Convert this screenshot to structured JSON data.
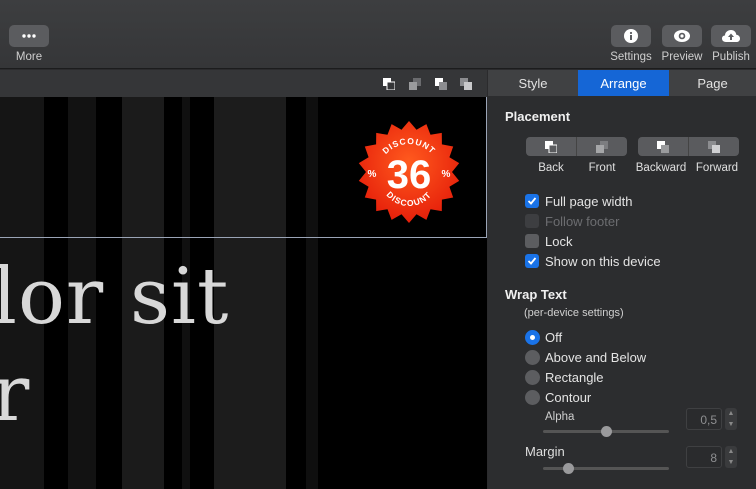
{
  "toolbar": {
    "more_label": "More",
    "settings_label": "Settings",
    "preview_label": "Preview",
    "publish_label": "Publish"
  },
  "canvas": {
    "headline_line1": "lor sit",
    "headline_line2": "r",
    "badge": {
      "top_text": "DISCOUNT",
      "bottom_text": "DISCOUNT",
      "value": "36",
      "left_pct": "%",
      "right_pct": "%"
    }
  },
  "inspector": {
    "tabs": [
      "Style",
      "Arrange",
      "Page"
    ],
    "active_tab": "Arrange",
    "placement": {
      "title": "Placement",
      "buttons": [
        "Back",
        "Front",
        "Backward",
        "Forward"
      ],
      "options": [
        {
          "label": "Full page width",
          "checked": true,
          "enabled": true
        },
        {
          "label": "Follow footer",
          "checked": false,
          "enabled": false
        },
        {
          "label": "Lock",
          "checked": false,
          "enabled": true
        },
        {
          "label": "Show on this device",
          "checked": true,
          "enabled": true
        }
      ]
    },
    "wrap_text": {
      "title": "Wrap Text",
      "subtitle": "(per-device settings)",
      "options": [
        {
          "label": "Off",
          "selected": true
        },
        {
          "label": "Above and Below",
          "selected": false
        },
        {
          "label": "Rectangle",
          "selected": false
        },
        {
          "label": "Contour",
          "selected": false
        }
      ],
      "alpha_label": "Alpha",
      "alpha_value": "0,5",
      "alpha_fraction": 0.5,
      "margin_label": "Margin",
      "margin_value": "8",
      "margin_fraction": 0.2
    }
  },
  "colors": {
    "accent": "#1a73e8",
    "tab_active": "#1566d6",
    "badge_red": "#f2300c"
  }
}
